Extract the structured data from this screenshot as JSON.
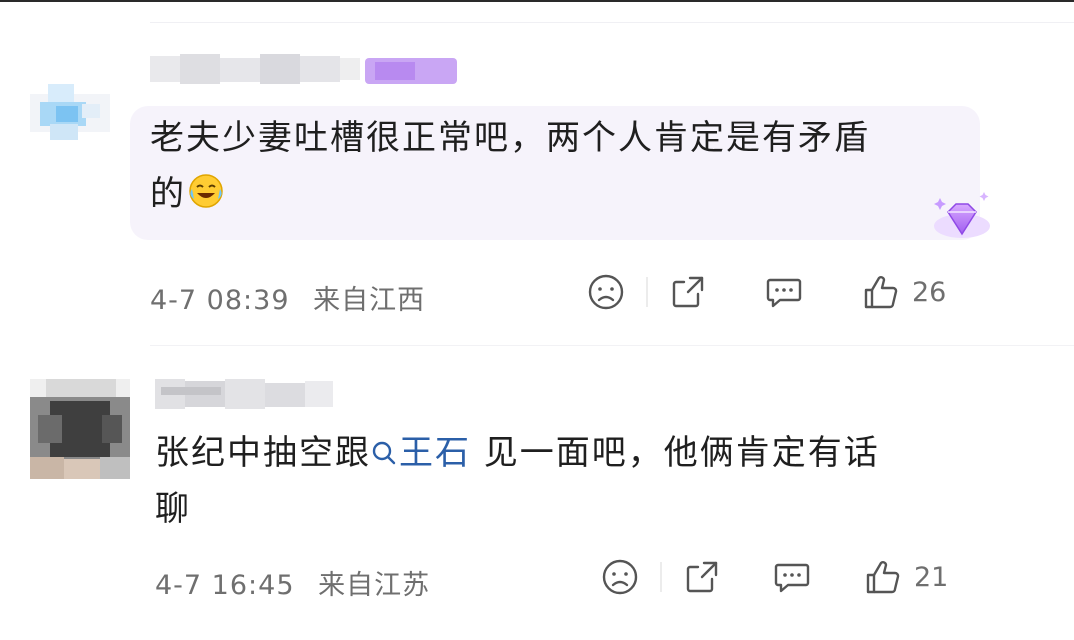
{
  "comments": [
    {
      "text": "老夫少妻吐槽很正常吧，两个人肯定是有矛盾的",
      "text_line1": "老夫少妻吐槽很正常吧，两个人肯定是有矛盾",
      "text_line2": "的",
      "time": "4-7 08:39",
      "location": "来自江西",
      "likes": "26",
      "emoji": "laughing-crying-emoji",
      "badge": "purple-gem-badge"
    },
    {
      "text_prefix": "张纪中抽空跟",
      "mention": "王石",
      "text_suffix_line1": " 见一面吧，他俩肯定有话",
      "text_line2": "聊",
      "time": "4-7 16:45",
      "location": "来自江苏",
      "likes": "21"
    }
  ],
  "icons": [
    "sad-face-icon",
    "share-icon",
    "comment-icon",
    "thumbs-up-icon"
  ],
  "colors": {
    "mention": "#2b5fa8",
    "meta": "#6f6f6f",
    "bubble": "#f6f3fb",
    "badge": "#b06cf0"
  }
}
